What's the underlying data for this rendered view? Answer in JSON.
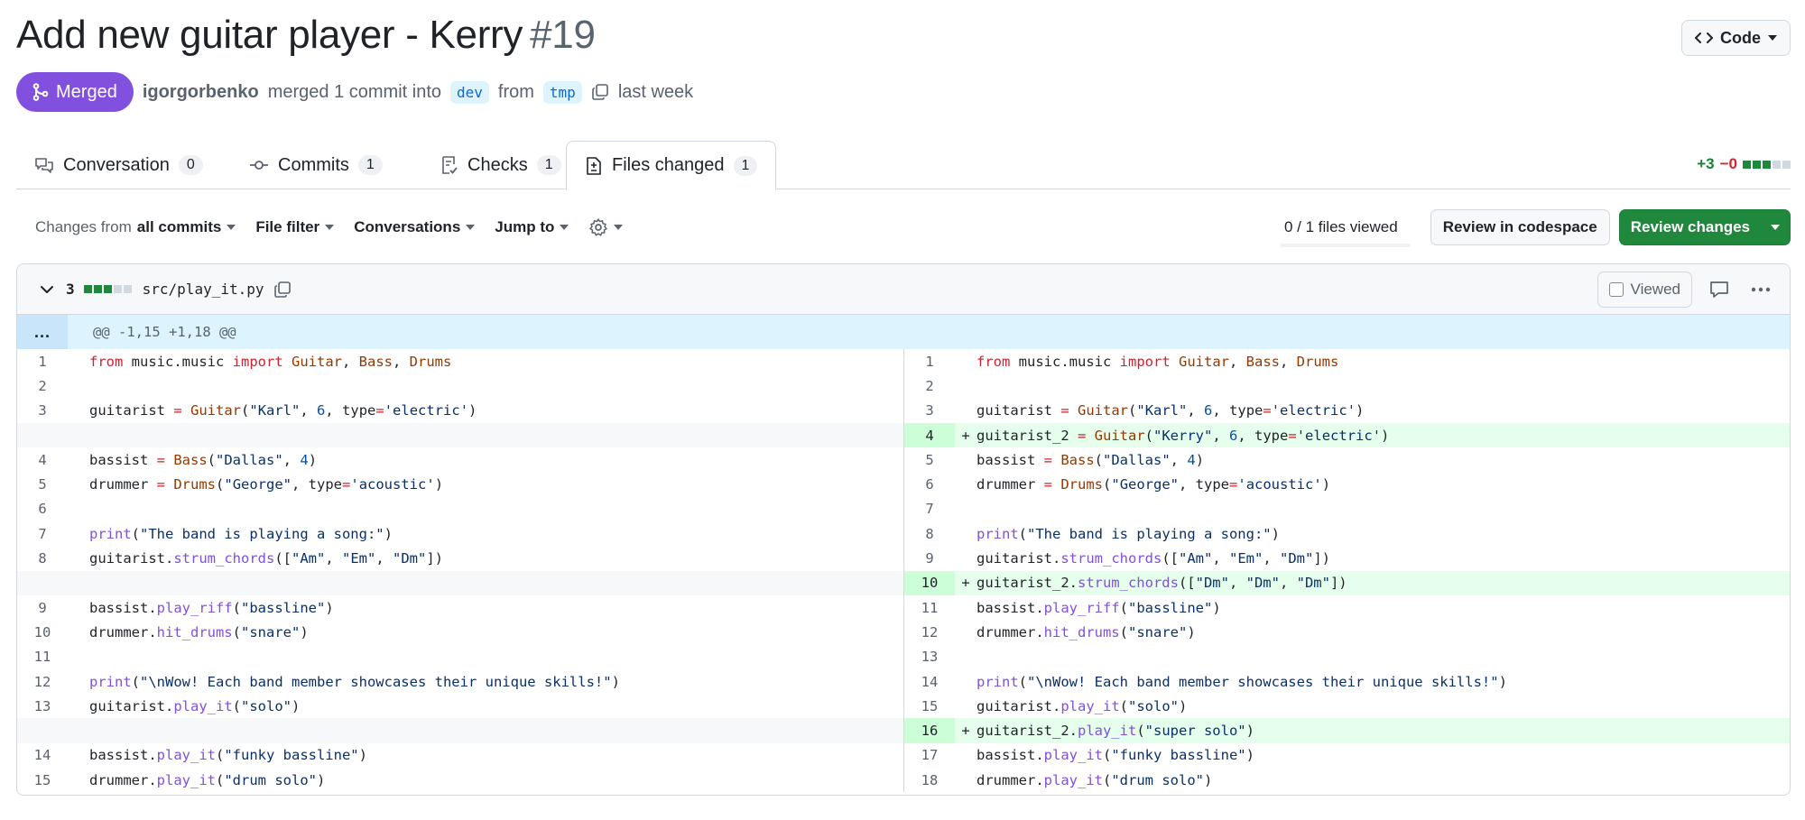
{
  "header": {
    "title": "Add new guitar player - Kerry",
    "number": "#19",
    "code_button": "Code"
  },
  "meta": {
    "status": "Merged",
    "author": "igorgorbenko",
    "action": "merged 1 commit into",
    "base_branch": "dev",
    "from": "from",
    "head_branch": "tmp",
    "time": "last week"
  },
  "tabs": [
    {
      "label": "Conversation",
      "count": "0",
      "icon": "comment-discussion-icon"
    },
    {
      "label": "Commits",
      "count": "1",
      "icon": "git-commit-icon"
    },
    {
      "label": "Checks",
      "count": "1",
      "icon": "checklist-icon"
    },
    {
      "label": "Files changed",
      "count": "1",
      "icon": "file-diff-icon",
      "active": true
    }
  ],
  "diffstat": {
    "additions": "+3",
    "deletions": "−0"
  },
  "toolbar": {
    "changes_prefix": "Changes from",
    "changes_value": "all commits",
    "file_filter": "File filter",
    "conversations": "Conversations",
    "jump_to": "Jump to",
    "files_viewed": "0 / 1 files viewed",
    "review_codespace": "Review in codespace",
    "review_changes": "Review changes"
  },
  "file": {
    "change_count": "3",
    "path": "src/play_it.py",
    "viewed_label": "Viewed",
    "hunk_expand": "...",
    "hunk_header": "@@ -1,15 +1,18 @@"
  },
  "colors": {
    "merged": "#8250df",
    "primary": "#1f883d",
    "added_bg": "#e6ffec",
    "added_ln": "#ccffd8",
    "hunk_bg": "#ddf4ff"
  },
  "diff": {
    "left": [
      {
        "ln": "1",
        "tokens": [
          [
            "kw",
            "from"
          ],
          [
            "pl",
            " music.music "
          ],
          [
            "kw",
            "import"
          ],
          [
            "pl",
            " "
          ],
          [
            "cls",
            "Guitar"
          ],
          [
            "pl",
            ", "
          ],
          [
            "cls",
            "Bass"
          ],
          [
            "pl",
            ", "
          ],
          [
            "cls",
            "Drums"
          ]
        ]
      },
      {
        "ln": "2",
        "tokens": []
      },
      {
        "ln": "3",
        "tokens": [
          [
            "pl",
            "guitarist "
          ],
          [
            "kw",
            "="
          ],
          [
            "pl",
            " "
          ],
          [
            "cls",
            "Guitar"
          ],
          [
            "pl",
            "("
          ],
          [
            "str",
            "\"Karl\""
          ],
          [
            "pl",
            ", "
          ],
          [
            "num",
            "6"
          ],
          [
            "pl",
            ", type"
          ],
          [
            "kw",
            "="
          ],
          [
            "str",
            "'electric'"
          ],
          [
            "pl",
            ")"
          ]
        ]
      },
      {
        "ln": "",
        "type": "empty",
        "tokens": []
      },
      {
        "ln": "4",
        "tokens": [
          [
            "pl",
            "bassist "
          ],
          [
            "kw",
            "="
          ],
          [
            "pl",
            " "
          ],
          [
            "cls",
            "Bass"
          ],
          [
            "pl",
            "("
          ],
          [
            "str",
            "\"Dallas\""
          ],
          [
            "pl",
            ", "
          ],
          [
            "num",
            "4"
          ],
          [
            "pl",
            ")"
          ]
        ]
      },
      {
        "ln": "5",
        "tokens": [
          [
            "pl",
            "drummer "
          ],
          [
            "kw",
            "="
          ],
          [
            "pl",
            " "
          ],
          [
            "cls",
            "Drums"
          ],
          [
            "pl",
            "("
          ],
          [
            "str",
            "\"George\""
          ],
          [
            "pl",
            ", type"
          ],
          [
            "kw",
            "="
          ],
          [
            "str",
            "'acoustic'"
          ],
          [
            "pl",
            ")"
          ]
        ]
      },
      {
        "ln": "6",
        "tokens": []
      },
      {
        "ln": "7",
        "tokens": [
          [
            "fn",
            "print"
          ],
          [
            "pl",
            "("
          ],
          [
            "str",
            "\"The band is playing a song:\""
          ],
          [
            "pl",
            ")"
          ]
        ]
      },
      {
        "ln": "8",
        "tokens": [
          [
            "pl",
            "guitarist."
          ],
          [
            "fn",
            "strum_chords"
          ],
          [
            "pl",
            "(["
          ],
          [
            "str",
            "\"Am\""
          ],
          [
            "pl",
            ", "
          ],
          [
            "str",
            "\"Em\""
          ],
          [
            "pl",
            ", "
          ],
          [
            "str",
            "\"Dm\""
          ],
          [
            "pl",
            "])"
          ]
        ]
      },
      {
        "ln": "",
        "type": "empty",
        "tokens": []
      },
      {
        "ln": "9",
        "tokens": [
          [
            "pl",
            "bassist."
          ],
          [
            "fn",
            "play_riff"
          ],
          [
            "pl",
            "("
          ],
          [
            "str",
            "\"bassline\""
          ],
          [
            "pl",
            ")"
          ]
        ]
      },
      {
        "ln": "10",
        "tokens": [
          [
            "pl",
            "drummer."
          ],
          [
            "fn",
            "hit_drums"
          ],
          [
            "pl",
            "("
          ],
          [
            "str",
            "\"snare\""
          ],
          [
            "pl",
            ")"
          ]
        ]
      },
      {
        "ln": "11",
        "tokens": []
      },
      {
        "ln": "12",
        "tokens": [
          [
            "fn",
            "print"
          ],
          [
            "pl",
            "("
          ],
          [
            "str",
            "\"\\nWow! Each band member showcases their unique skills!\""
          ],
          [
            "pl",
            ")"
          ]
        ]
      },
      {
        "ln": "13",
        "tokens": [
          [
            "pl",
            "guitarist."
          ],
          [
            "fn",
            "play_it"
          ],
          [
            "pl",
            "("
          ],
          [
            "str",
            "\"solo\""
          ],
          [
            "pl",
            ")"
          ]
        ]
      },
      {
        "ln": "",
        "type": "empty",
        "tokens": []
      },
      {
        "ln": "14",
        "tokens": [
          [
            "pl",
            "bassist."
          ],
          [
            "fn",
            "play_it"
          ],
          [
            "pl",
            "("
          ],
          [
            "str",
            "\"funky bassline\""
          ],
          [
            "pl",
            ")"
          ]
        ]
      },
      {
        "ln": "15",
        "tokens": [
          [
            "pl",
            "drummer."
          ],
          [
            "fn",
            "play_it"
          ],
          [
            "pl",
            "("
          ],
          [
            "str",
            "\"drum solo\""
          ],
          [
            "pl",
            ")"
          ]
        ]
      }
    ],
    "right": [
      {
        "ln": "1",
        "tokens": [
          [
            "kw",
            "from"
          ],
          [
            "pl",
            " music.music "
          ],
          [
            "kw",
            "import"
          ],
          [
            "pl",
            " "
          ],
          [
            "cls",
            "Guitar"
          ],
          [
            "pl",
            ", "
          ],
          [
            "cls",
            "Bass"
          ],
          [
            "pl",
            ", "
          ],
          [
            "cls",
            "Drums"
          ]
        ]
      },
      {
        "ln": "2",
        "tokens": []
      },
      {
        "ln": "3",
        "tokens": [
          [
            "pl",
            "guitarist "
          ],
          [
            "kw",
            "="
          ],
          [
            "pl",
            " "
          ],
          [
            "cls",
            "Guitar"
          ],
          [
            "pl",
            "("
          ],
          [
            "str",
            "\"Karl\""
          ],
          [
            "pl",
            ", "
          ],
          [
            "num",
            "6"
          ],
          [
            "pl",
            ", type"
          ],
          [
            "kw",
            "="
          ],
          [
            "str",
            "'electric'"
          ],
          [
            "pl",
            ")"
          ]
        ]
      },
      {
        "ln": "4",
        "type": "add",
        "mark": "+",
        "tokens": [
          [
            "pl",
            "guitarist_2 "
          ],
          [
            "kw",
            "="
          ],
          [
            "pl",
            " "
          ],
          [
            "cls",
            "Guitar"
          ],
          [
            "pl",
            "("
          ],
          [
            "str",
            "\"Kerry\""
          ],
          [
            "pl",
            ", "
          ],
          [
            "num",
            "6"
          ],
          [
            "pl",
            ", type"
          ],
          [
            "kw",
            "="
          ],
          [
            "str",
            "'electric'"
          ],
          [
            "pl",
            ")"
          ]
        ]
      },
      {
        "ln": "5",
        "tokens": [
          [
            "pl",
            "bassist "
          ],
          [
            "kw",
            "="
          ],
          [
            "pl",
            " "
          ],
          [
            "cls",
            "Bass"
          ],
          [
            "pl",
            "("
          ],
          [
            "str",
            "\"Dallas\""
          ],
          [
            "pl",
            ", "
          ],
          [
            "num",
            "4"
          ],
          [
            "pl",
            ")"
          ]
        ]
      },
      {
        "ln": "6",
        "tokens": [
          [
            "pl",
            "drummer "
          ],
          [
            "kw",
            "="
          ],
          [
            "pl",
            " "
          ],
          [
            "cls",
            "Drums"
          ],
          [
            "pl",
            "("
          ],
          [
            "str",
            "\"George\""
          ],
          [
            "pl",
            ", type"
          ],
          [
            "kw",
            "="
          ],
          [
            "str",
            "'acoustic'"
          ],
          [
            "pl",
            ")"
          ]
        ]
      },
      {
        "ln": "7",
        "tokens": []
      },
      {
        "ln": "8",
        "tokens": [
          [
            "fn",
            "print"
          ],
          [
            "pl",
            "("
          ],
          [
            "str",
            "\"The band is playing a song:\""
          ],
          [
            "pl",
            ")"
          ]
        ]
      },
      {
        "ln": "9",
        "tokens": [
          [
            "pl",
            "guitarist."
          ],
          [
            "fn",
            "strum_chords"
          ],
          [
            "pl",
            "(["
          ],
          [
            "str",
            "\"Am\""
          ],
          [
            "pl",
            ", "
          ],
          [
            "str",
            "\"Em\""
          ],
          [
            "pl",
            ", "
          ],
          [
            "str",
            "\"Dm\""
          ],
          [
            "pl",
            "])"
          ]
        ]
      },
      {
        "ln": "10",
        "type": "add",
        "mark": "+",
        "tokens": [
          [
            "pl",
            "guitarist_2."
          ],
          [
            "fn",
            "strum_chords"
          ],
          [
            "pl",
            "(["
          ],
          [
            "str",
            "\"Dm\""
          ],
          [
            "pl",
            ", "
          ],
          [
            "str",
            "\"Dm\""
          ],
          [
            "pl",
            ", "
          ],
          [
            "str",
            "\"Dm\""
          ],
          [
            "pl",
            "])"
          ]
        ]
      },
      {
        "ln": "11",
        "tokens": [
          [
            "pl",
            "bassist."
          ],
          [
            "fn",
            "play_riff"
          ],
          [
            "pl",
            "("
          ],
          [
            "str",
            "\"bassline\""
          ],
          [
            "pl",
            ")"
          ]
        ]
      },
      {
        "ln": "12",
        "tokens": [
          [
            "pl",
            "drummer."
          ],
          [
            "fn",
            "hit_drums"
          ],
          [
            "pl",
            "("
          ],
          [
            "str",
            "\"snare\""
          ],
          [
            "pl",
            ")"
          ]
        ]
      },
      {
        "ln": "13",
        "tokens": []
      },
      {
        "ln": "14",
        "tokens": [
          [
            "fn",
            "print"
          ],
          [
            "pl",
            "("
          ],
          [
            "str",
            "\"\\nWow! Each band member showcases their unique skills!\""
          ],
          [
            "pl",
            ")"
          ]
        ]
      },
      {
        "ln": "15",
        "tokens": [
          [
            "pl",
            "guitarist."
          ],
          [
            "fn",
            "play_it"
          ],
          [
            "pl",
            "("
          ],
          [
            "str",
            "\"solo\""
          ],
          [
            "pl",
            ")"
          ]
        ]
      },
      {
        "ln": "16",
        "type": "add",
        "mark": "+",
        "tokens": [
          [
            "pl",
            "guitarist_2."
          ],
          [
            "fn",
            "play_it"
          ],
          [
            "pl",
            "("
          ],
          [
            "str",
            "\"super solo\""
          ],
          [
            "pl",
            ")"
          ]
        ]
      },
      {
        "ln": "17",
        "tokens": [
          [
            "pl",
            "bassist."
          ],
          [
            "fn",
            "play_it"
          ],
          [
            "pl",
            "("
          ],
          [
            "str",
            "\"funky bassline\""
          ],
          [
            "pl",
            ")"
          ]
        ]
      },
      {
        "ln": "18",
        "tokens": [
          [
            "pl",
            "drummer."
          ],
          [
            "fn",
            "play_it"
          ],
          [
            "pl",
            "("
          ],
          [
            "str",
            "\"drum solo\""
          ],
          [
            "pl",
            ")"
          ]
        ]
      }
    ]
  }
}
